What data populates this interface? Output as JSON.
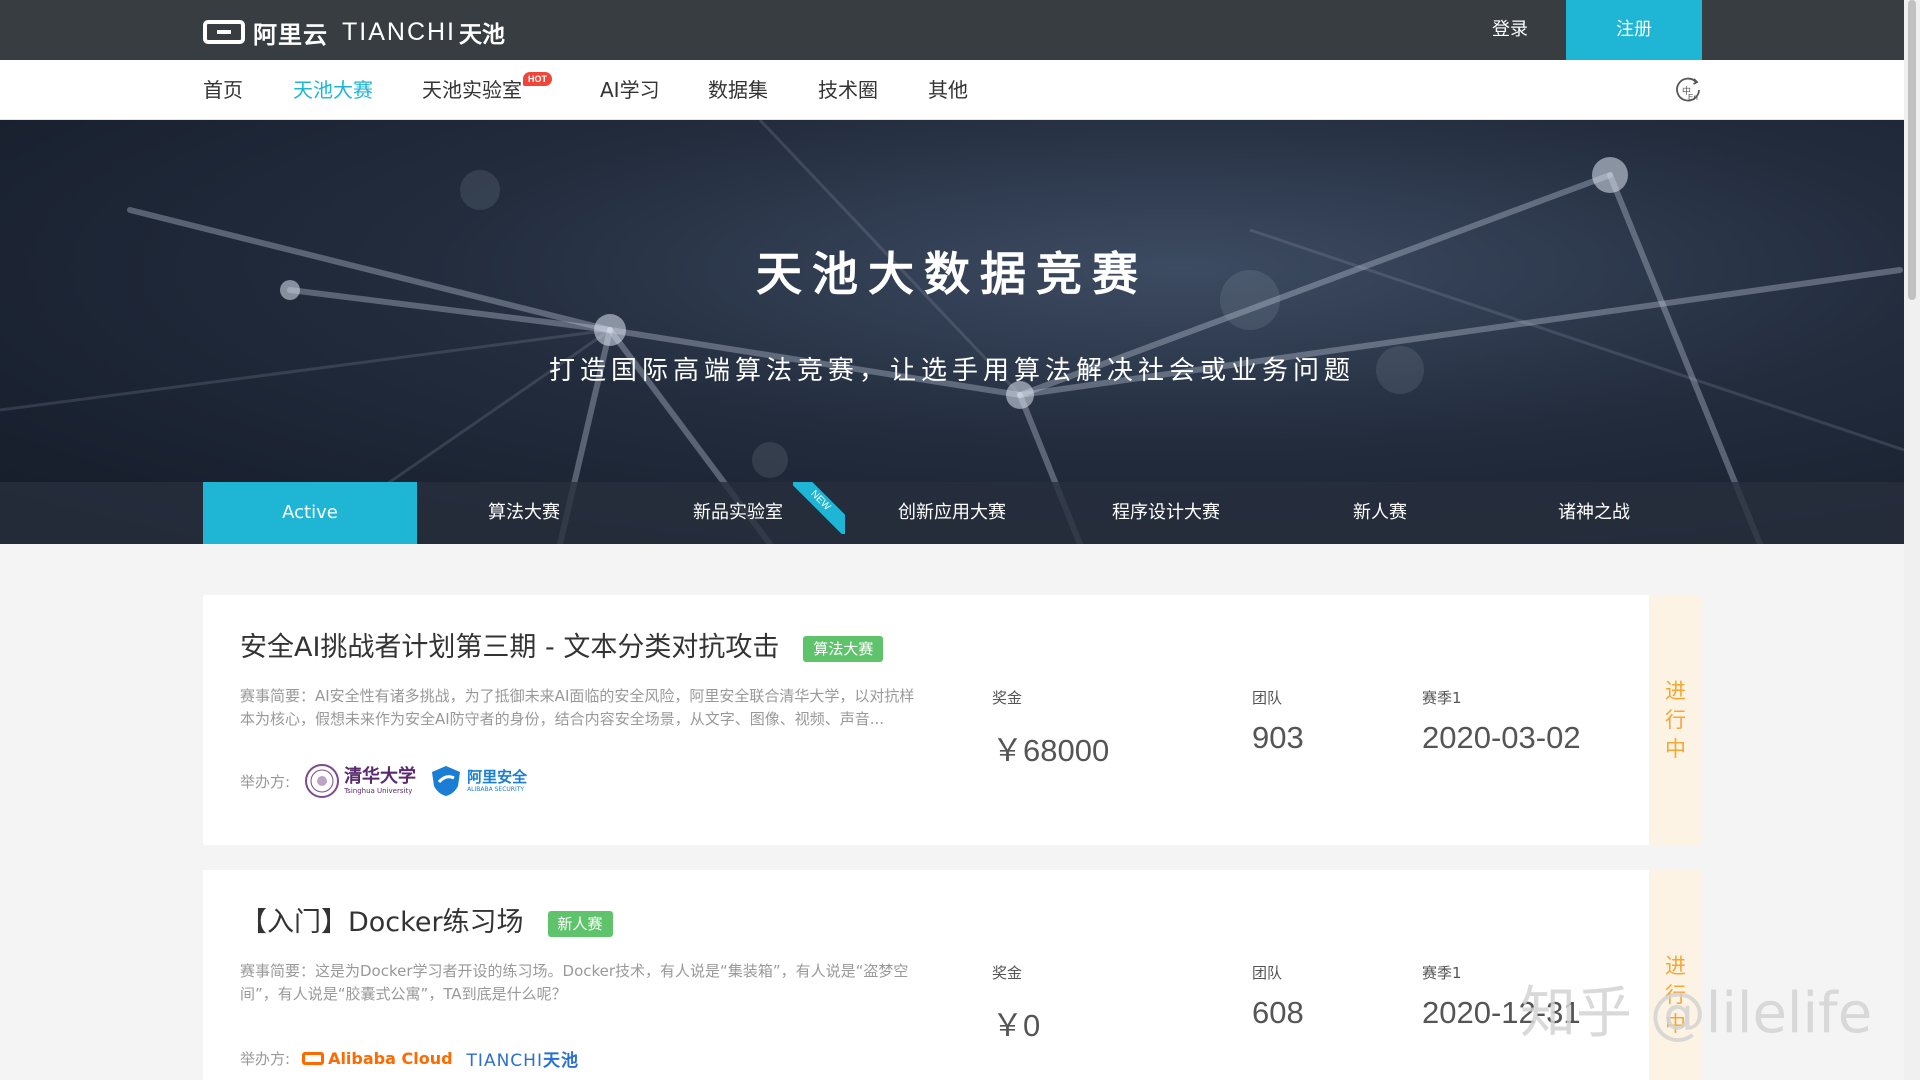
{
  "header": {
    "logo_aliyun": "阿里云",
    "logo_tianchi": "TIANCHI",
    "logo_tianchi_cn": "天池",
    "login_label": "登录",
    "register_label": "注册"
  },
  "nav": {
    "items": [
      {
        "label": "首页"
      },
      {
        "label": "天池大赛"
      },
      {
        "label": "天池实验室"
      },
      {
        "label": "AI学习"
      },
      {
        "label": "数据集"
      },
      {
        "label": "技术圈"
      },
      {
        "label": "其他"
      }
    ],
    "hot_badge": "HOT",
    "lang_icon": "language-switch-icon"
  },
  "banner": {
    "title": "天池大数据竞赛",
    "subtitle": "打造国际高端算法竞赛，让选手用算法解决社会或业务问题"
  },
  "tabs": {
    "items": [
      {
        "label": "Active"
      },
      {
        "label": "算法大赛"
      },
      {
        "label": "新品实验室"
      },
      {
        "label": "创新应用大赛"
      },
      {
        "label": "程序设计大赛"
      },
      {
        "label": "新人赛"
      },
      {
        "label": "诸神之战"
      }
    ],
    "new_ribbon": "NEW"
  },
  "competitions": [
    {
      "title": "安全AI挑战者计划第三期 - 文本分类对抗攻击",
      "tag": "算法大赛",
      "tag_color": "#5fc36b",
      "desc": "赛事简要：AI安全性有诸多挑战，为了抵御未来AI面临的安全风险，阿里安全联合清华大学，以对抗样本为核心，假想未来作为安全AI防守者的身份，结合内容安全场景，从文字、图像、视频、声音...",
      "org_label": "举办方:",
      "orgs": [
        "清华大学",
        "Tsinghua University",
        "阿里安全",
        "ALIBABA SECURITY"
      ],
      "prize_label": "奖金",
      "prize": "￥68000",
      "team_label": "团队",
      "teams": "903",
      "season_label": "赛季1",
      "season_date": "2020-03-02",
      "status": [
        "进",
        "行",
        "中"
      ]
    },
    {
      "title": "【入门】Docker练习场",
      "tag": "新人赛",
      "tag_color": "#5fc36b",
      "desc": "赛事简要：这是为Docker学习者开设的练习场。Docker技术，有人说是“集装箱”，有人说是“盗梦空间”，有人说是“胶囊式公寓”，TA到底是什么呢？",
      "org_label": "举办方:",
      "orgs": [
        "Alibaba Cloud",
        "TIANCHI",
        "天池"
      ],
      "prize_label": "奖金",
      "prize": "￥0",
      "team_label": "团队",
      "teams": "608",
      "season_label": "赛季1",
      "season_date": "2020-12-31",
      "status": [
        "进",
        "行",
        "中"
      ]
    }
  ],
  "watermark": "知乎 @lilelife",
  "colors": {
    "accent": "#1fb5d5",
    "topbar": "#373d41",
    "status_text": "#f5a733",
    "status_bg": "#fdf3e4",
    "hot": "#f0463a"
  }
}
